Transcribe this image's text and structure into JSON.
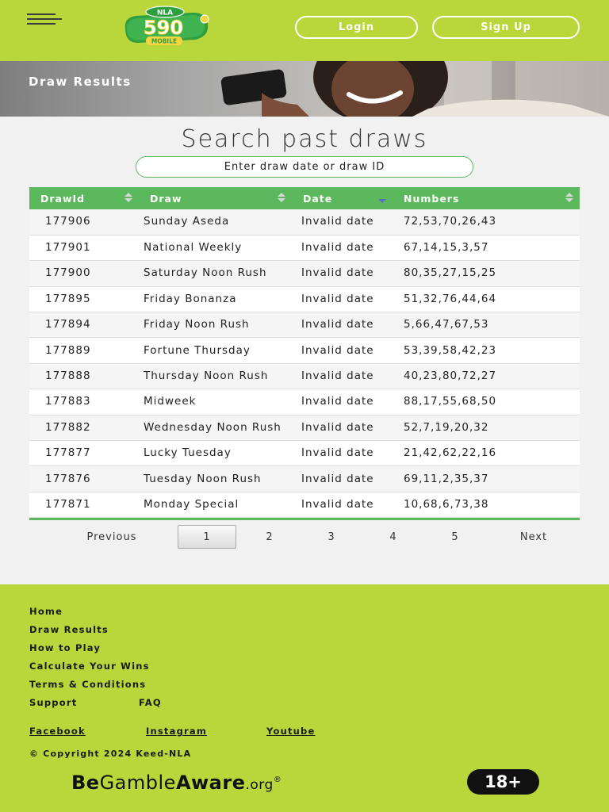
{
  "header": {
    "logo_top": "NLA",
    "logo_main": "590",
    "logo_sub": "MOBILE",
    "login_label": "Login",
    "signup_label": "Sign Up"
  },
  "banner": {
    "title": "Draw Results"
  },
  "search": {
    "title": "Search past draws",
    "placeholder": "Enter draw date or draw ID"
  },
  "table": {
    "columns": [
      "DrawId",
      "Draw",
      "Date",
      "Numbers"
    ],
    "rows": [
      {
        "id": "177906",
        "draw": "Sunday Aseda",
        "date": "Invalid date",
        "numbers": "72,53,70,26,43"
      },
      {
        "id": "177901",
        "draw": "National Weekly",
        "date": "Invalid date",
        "numbers": "67,14,15,3,57"
      },
      {
        "id": "177900",
        "draw": "Saturday Noon Rush",
        "date": "Invalid date",
        "numbers": "80,35,27,15,25"
      },
      {
        "id": "177895",
        "draw": "Friday Bonanza",
        "date": "Invalid date",
        "numbers": "51,32,76,44,64"
      },
      {
        "id": "177894",
        "draw": "Friday Noon Rush",
        "date": "Invalid date",
        "numbers": "5,66,47,67,53"
      },
      {
        "id": "177889",
        "draw": "Fortune Thursday",
        "date": "Invalid date",
        "numbers": "53,39,58,42,23"
      },
      {
        "id": "177888",
        "draw": "Thursday Noon Rush",
        "date": "Invalid date",
        "numbers": "40,23,80,72,27"
      },
      {
        "id": "177883",
        "draw": "Midweek",
        "date": "Invalid date",
        "numbers": "88,17,55,68,50"
      },
      {
        "id": "177882",
        "draw": "Wednesday Noon Rush",
        "date": "Invalid date",
        "numbers": "52,7,19,20,32"
      },
      {
        "id": "177877",
        "draw": "Lucky Tuesday",
        "date": "Invalid date",
        "numbers": "21,42,62,22,16"
      },
      {
        "id": "177876",
        "draw": "Tuesday Noon Rush",
        "date": "Invalid date",
        "numbers": "69,11,2,35,37"
      },
      {
        "id": "177871",
        "draw": "Monday Special",
        "date": "Invalid date",
        "numbers": "10,68,6,73,38"
      }
    ]
  },
  "pagination": {
    "previous_label": "Previous",
    "pages": [
      "1",
      "2",
      "3",
      "4",
      "5"
    ],
    "active_page": "1",
    "next_label": "Next"
  },
  "footer": {
    "links": [
      "Home",
      "Draw Results",
      "How to Play",
      "Calculate Your Wins",
      "Terms & Conditions",
      "Support",
      "FAQ"
    ],
    "social": [
      "Facebook",
      "Instagram",
      "Youtube"
    ],
    "copyright": "© Copyright 2024 Keed-NLA",
    "gamble_be": "Be",
    "gamble_gamble": "Gamble",
    "gamble_aware": "Aware",
    "gamble_org": ".org",
    "gamble_reg": "®",
    "age_badge": "18+"
  },
  "colors": {
    "brand_lime": "#b9d63a",
    "table_green": "#5cb85c",
    "sort_active": "#5b6cc9"
  },
  "icons": {
    "menu": "hamburger-menu-icon",
    "sort": "sort-arrows-icon",
    "sort_desc": "sort-descending-icon"
  }
}
